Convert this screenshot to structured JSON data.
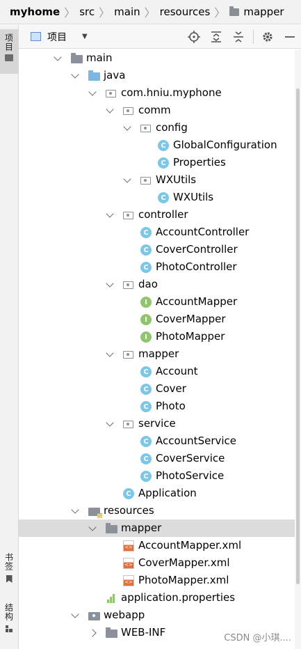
{
  "breadcrumb": [
    {
      "label": "myhome",
      "bold": true
    },
    {
      "label": "src"
    },
    {
      "label": "main"
    },
    {
      "label": "resources"
    },
    {
      "label": "mapper",
      "folder_icon": true
    }
  ],
  "left_strip": {
    "project_tab": "项目",
    "bookmarks_tab": "书签",
    "structure_tab": "结构"
  },
  "toolbar": {
    "view_label": "项目"
  },
  "tree": [
    {
      "label": "main",
      "icon": "folder-icon",
      "indent": 0,
      "expanded": true
    },
    {
      "label": "java",
      "icon": "source-folder-icon",
      "indent": 1,
      "expanded": true
    },
    {
      "label": "com.hniu.myphone",
      "icon": "package-icon",
      "indent": 2,
      "expanded": true
    },
    {
      "label": "comm",
      "icon": "package-icon",
      "indent": 3,
      "expanded": true
    },
    {
      "label": "config",
      "icon": "package-icon",
      "indent": 4,
      "expanded": true
    },
    {
      "label": "GlobalConfiguration",
      "icon": "class-icon",
      "indent": 5
    },
    {
      "label": "Properties",
      "icon": "class-icon",
      "indent": 5
    },
    {
      "label": "WXUtils",
      "icon": "package-icon",
      "indent": 4,
      "expanded": true
    },
    {
      "label": "WXUtils",
      "icon": "class-icon",
      "indent": 5
    },
    {
      "label": "controller",
      "icon": "package-icon",
      "indent": 3,
      "expanded": true
    },
    {
      "label": "AccountController",
      "icon": "class-icon",
      "indent": 4
    },
    {
      "label": "CoverController",
      "icon": "class-icon",
      "indent": 4
    },
    {
      "label": "PhotoController",
      "icon": "class-icon",
      "indent": 4
    },
    {
      "label": "dao",
      "icon": "package-icon",
      "indent": 3,
      "expanded": true
    },
    {
      "label": "AccountMapper",
      "icon": "interface-icon",
      "indent": 4
    },
    {
      "label": "CoverMapper",
      "icon": "interface-icon",
      "indent": 4
    },
    {
      "label": "PhotoMapper",
      "icon": "interface-icon",
      "indent": 4
    },
    {
      "label": "mapper",
      "icon": "package-icon",
      "indent": 3,
      "expanded": true
    },
    {
      "label": "Account",
      "icon": "class-icon",
      "indent": 4
    },
    {
      "label": "Cover",
      "icon": "class-icon",
      "indent": 4
    },
    {
      "label": "Photo",
      "icon": "class-icon",
      "indent": 4
    },
    {
      "label": "service",
      "icon": "package-icon",
      "indent": 3,
      "expanded": true
    },
    {
      "label": "AccountService",
      "icon": "class-icon",
      "indent": 4
    },
    {
      "label": "CoverService",
      "icon": "class-icon",
      "indent": 4
    },
    {
      "label": "PhotoService",
      "icon": "class-icon",
      "indent": 4
    },
    {
      "label": "Application",
      "icon": "class-icon",
      "indent": 3
    },
    {
      "label": "resources",
      "icon": "resources-folder-icon",
      "indent": 1,
      "expanded": true
    },
    {
      "label": "mapper",
      "icon": "folder-icon",
      "indent": 2,
      "expanded": true,
      "selected": true
    },
    {
      "label": "AccountMapper.xml",
      "icon": "xml-file-icon",
      "indent": 3
    },
    {
      "label": "CoverMapper.xml",
      "icon": "xml-file-icon",
      "indent": 3
    },
    {
      "label": "PhotoMapper.xml",
      "icon": "xml-file-icon",
      "indent": 3
    },
    {
      "label": "application.properties",
      "icon": "properties-file-icon",
      "indent": 2
    },
    {
      "label": "webapp",
      "icon": "web-folder-icon",
      "indent": 1,
      "expanded": true
    },
    {
      "label": "WEB-INF",
      "icon": "folder-icon",
      "indent": 2,
      "expanded": false
    }
  ],
  "watermark": "CSDN @小琪...."
}
